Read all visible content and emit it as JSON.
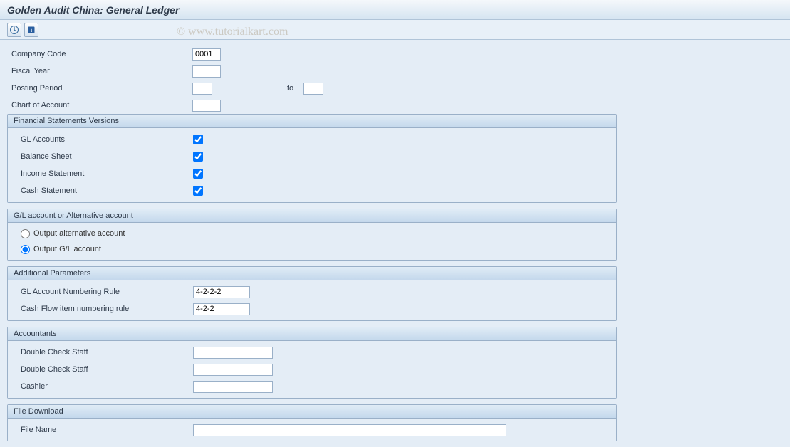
{
  "title": "Golden Audit China: General Ledger",
  "watermark": "© www.tutorialkart.com",
  "fields": {
    "company_code": {
      "label": "Company Code",
      "value": "0001"
    },
    "fiscal_year": {
      "label": "Fiscal Year",
      "value": ""
    },
    "posting_period": {
      "label": "Posting Period",
      "from": "",
      "to_label": "to",
      "to": ""
    },
    "chart_of_account": {
      "label": "Chart of Account",
      "value": ""
    }
  },
  "groups": {
    "fsv": {
      "title": "Financial Statements Versions",
      "items": {
        "gl": {
          "label": "GL Accounts",
          "checked": true
        },
        "bs": {
          "label": "Balance Sheet",
          "checked": true
        },
        "is": {
          "label": "Income Statement",
          "checked": true
        },
        "cs": {
          "label": "Cash Statement",
          "checked": true
        }
      }
    },
    "account_output": {
      "title": "G/L account or Alternative account",
      "options": {
        "alt": {
          "label": "Output alternative account",
          "selected": false
        },
        "gl": {
          "label": "Output G/L account",
          "selected": true
        }
      }
    },
    "additional": {
      "title": "Additional Parameters",
      "items": {
        "gl_rule": {
          "label": "GL Account Numbering Rule",
          "value": "4-2-2-2"
        },
        "cf_rule": {
          "label": "Cash Flow item numbering rule",
          "value": "4-2-2"
        }
      }
    },
    "accountants": {
      "title": "Accountants",
      "items": {
        "dcs1": {
          "label": "Double Check Staff",
          "value": ""
        },
        "dcs2": {
          "label": "Double Check Staff",
          "value": ""
        },
        "cashier": {
          "label": "Cashier",
          "value": ""
        }
      }
    },
    "file": {
      "title": "File Download",
      "items": {
        "name": {
          "label": "File Name",
          "value": ""
        }
      }
    }
  }
}
